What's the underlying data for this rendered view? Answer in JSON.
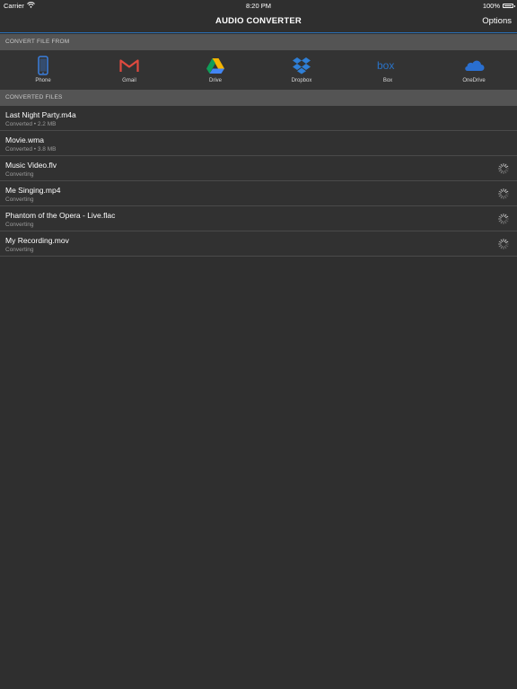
{
  "status_bar": {
    "carrier": "Carrier",
    "time": "8:20 PM",
    "battery": "100%"
  },
  "nav": {
    "title": "AUDIO CONVERTER",
    "options_label": "Options"
  },
  "convert_from": {
    "header": "CONVERT FILE FROM",
    "sources": [
      {
        "label": "Phone",
        "icon": "phone-icon",
        "color": "#3a7fe0"
      },
      {
        "label": "Gmail",
        "icon": "gmail-icon",
        "color": "#e04a3f"
      },
      {
        "label": "Drive",
        "icon": "drive-icon",
        "color": "#1e9b4a"
      },
      {
        "label": "Dropbox",
        "icon": "dropbox-icon",
        "color": "#2f7fd6"
      },
      {
        "label": "Box",
        "icon": "box-icon",
        "color": "#2a73c8"
      },
      {
        "label": "OneDrive",
        "icon": "onedrive-icon",
        "color": "#2a6fd0"
      }
    ]
  },
  "converted_files": {
    "header": "CONVERTED FILES",
    "files": [
      {
        "name": "Last Night Party.m4a",
        "status": "Converted • 2.2 MB",
        "converting": false
      },
      {
        "name": "Movie.wma",
        "status": "Converted • 3.8 MB",
        "converting": false
      },
      {
        "name": "Music Video.flv",
        "status": "Converting",
        "converting": true
      },
      {
        "name": "Me Singing.mp4",
        "status": "Converting",
        "converting": true
      },
      {
        "name": "Phantom of the Opera - Live.flac",
        "status": "Converting",
        "converting": true
      },
      {
        "name": "My Recording.mov",
        "status": "Converting",
        "converting": true
      }
    ]
  },
  "colors": {
    "accent": "#2a6fb5",
    "background": "#2f2f2f",
    "section_header": "#545454"
  }
}
